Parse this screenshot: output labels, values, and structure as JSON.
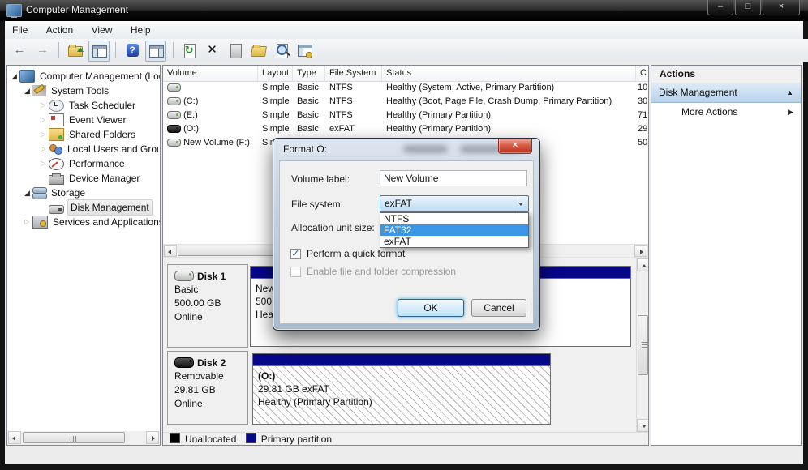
{
  "window": {
    "title": "Computer Management"
  },
  "icons": {
    "minimize": "–",
    "maximize": "□",
    "close": "×",
    "tree_expanded": "◢",
    "tree_collapsed": "▷",
    "back": "←",
    "forward": "→",
    "refresh": "↻",
    "delete": "✕",
    "help": "?",
    "combo_arrow": "▼",
    "check": "✓",
    "collapse": "▲",
    "expand": "▶"
  },
  "menu": {
    "items": [
      "File",
      "Action",
      "View",
      "Help"
    ]
  },
  "toolbar": {
    "icons": [
      "back-icon",
      "forward-icon",
      "up-folder-icon",
      "console-tree-icon",
      "help-icon",
      "action-pane-icon",
      "refresh-icon",
      "delete-icon",
      "properties-icon",
      "open-folder-icon",
      "find-icon",
      "settings-window-icon"
    ]
  },
  "sidebar": {
    "items": [
      {
        "label": "Computer Management (Local)",
        "icon": "computer-icon"
      },
      {
        "label": "System Tools",
        "icon": "system-tools-icon"
      },
      {
        "label": "Task Scheduler",
        "icon": "task-scheduler-icon"
      },
      {
        "label": "Event Viewer",
        "icon": "event-viewer-icon"
      },
      {
        "label": "Shared Folders",
        "icon": "shared-folders-icon"
      },
      {
        "label": "Local Users and Groups",
        "icon": "users-icon"
      },
      {
        "label": "Performance",
        "icon": "performance-icon"
      },
      {
        "label": "Device Manager",
        "icon": "device-manager-icon"
      },
      {
        "label": "Storage",
        "icon": "storage-icon"
      },
      {
        "label": "Disk Management",
        "icon": "disk-management-icon"
      },
      {
        "label": "Services and Applications",
        "icon": "services-icon"
      }
    ]
  },
  "volumes": {
    "columns": [
      "Volume",
      "Layout",
      "Type",
      "File System",
      "Status",
      "C"
    ],
    "rows": [
      {
        "volume": "",
        "layout": "Simple",
        "type": "Basic",
        "fs": "NTFS",
        "status": "Healthy (System, Active, Primary Partition)",
        "cap": "10"
      },
      {
        "volume": "(C:)",
        "layout": "Simple",
        "type": "Basic",
        "fs": "NTFS",
        "status": "Healthy (Boot, Page File, Crash Dump, Primary Partition)",
        "cap": "30"
      },
      {
        "volume": "(E:)",
        "layout": "Simple",
        "type": "Basic",
        "fs": "NTFS",
        "status": "Healthy (Primary Partition)",
        "cap": "71"
      },
      {
        "volume": "(O:)",
        "layout": "Simple",
        "type": "Basic",
        "fs": "exFAT",
        "status": "Healthy (Primary Partition)",
        "cap": "29"
      },
      {
        "volume": "New Volume (F:)",
        "layout": "Simple",
        "type": "",
        "fs": "",
        "status": "",
        "cap": "50"
      }
    ]
  },
  "actions": {
    "header": "Actions",
    "group": "Disk Management",
    "more": "More Actions"
  },
  "disks": [
    {
      "name": "Disk 1",
      "kind": "Basic",
      "size": "500.00 GB",
      "state": "Online",
      "partition": {
        "line1": "New",
        "line2": "500",
        "line3": "Hea"
      }
    },
    {
      "name": "Disk 2",
      "kind": "Removable",
      "size": "29.81 GB",
      "state": "Online",
      "partition": {
        "line1": "(O:)",
        "line2": "29.81 GB exFAT",
        "line3": "Healthy (Primary Partition)"
      }
    }
  ],
  "legend": [
    {
      "label": "Unallocated",
      "color": "#000000"
    },
    {
      "label": "Primary partition",
      "color": "#070789"
    }
  ],
  "dialog": {
    "title": "Format O:",
    "volume_label": {
      "label": "Volume label:",
      "value": "New Volume"
    },
    "file_system": {
      "label": "File system:",
      "value": "exFAT",
      "options": [
        "NTFS",
        "FAT32",
        "exFAT"
      ],
      "highlighted": "FAT32"
    },
    "allocation": {
      "label": "Allocation unit size:"
    },
    "quick_format": {
      "label": "Perform a quick format",
      "checked": true
    },
    "compression": {
      "label": "Enable file and folder compression",
      "checked": false,
      "disabled": true
    },
    "buttons": {
      "ok": "OK",
      "cancel": "Cancel"
    }
  }
}
